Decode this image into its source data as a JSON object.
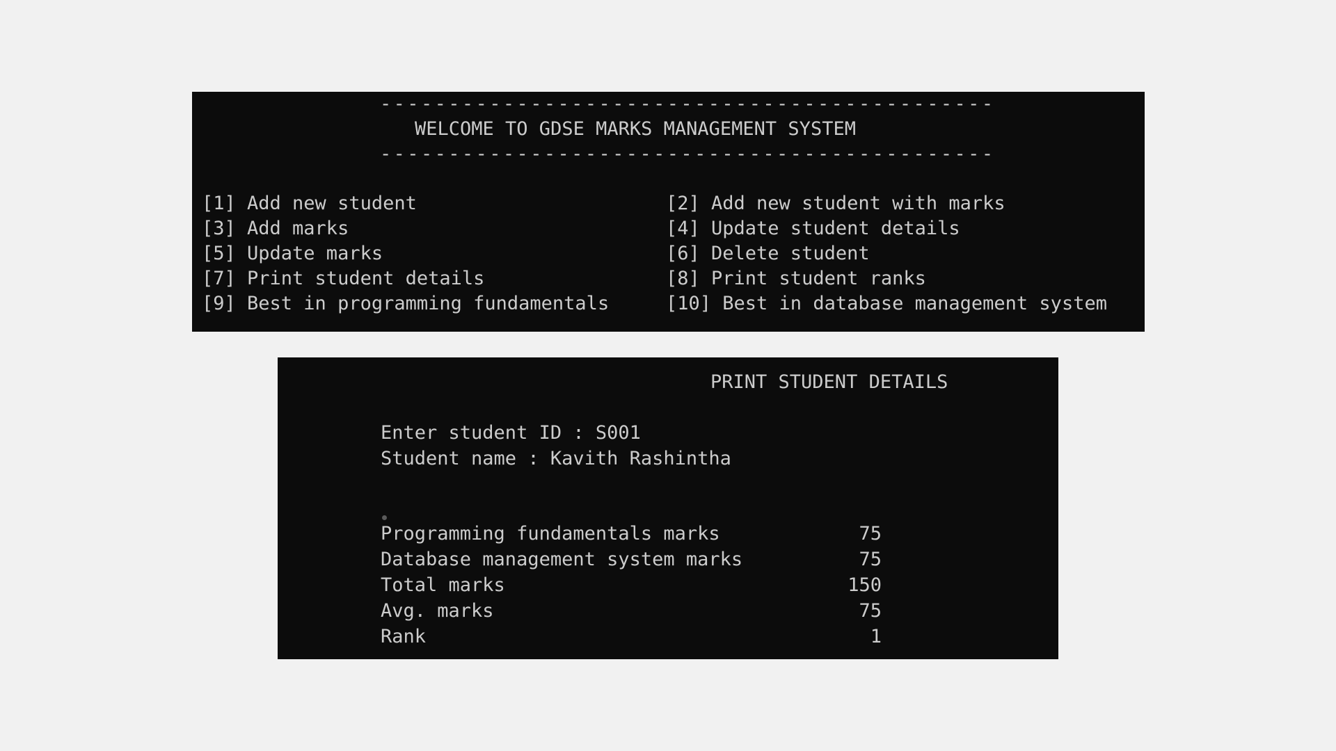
{
  "menu_window": {
    "dash_top": "---------------------------------------------",
    "title": "WELCOME TO GDSE MARKS MANAGEMENT SYSTEM",
    "dash_bottom": "---------------------------------------------",
    "options": [
      {
        "label": "[1] Add new student"
      },
      {
        "label": "[2] Add new student with marks"
      },
      {
        "label": "[3] Add marks"
      },
      {
        "label": "[4] Update student details"
      },
      {
        "label": "[5] Update marks"
      },
      {
        "label": "[6] Delete student"
      },
      {
        "label": "[7] Print student details"
      },
      {
        "label": "[8] Print student ranks"
      },
      {
        "label": "[9] Best in programming fundamentals"
      },
      {
        "label": "[10] Best in database management system"
      }
    ]
  },
  "details_window": {
    "title": "PRINT STUDENT DETAILS",
    "student_id_prompt": "Enter student ID : S001",
    "student_name_line": "Student name : Kavith Rashintha",
    "rows": [
      {
        "label": "Programming fundamentals marks",
        "value": "75"
      },
      {
        "label": "Database management system marks",
        "value": "75"
      },
      {
        "label": "Total marks",
        "value": "150"
      },
      {
        "label": "Avg. marks",
        "value": "75"
      },
      {
        "label": "Rank",
        "value": "1"
      }
    ]
  },
  "colors": {
    "page_background": "#f1f1f1",
    "terminal_background": "#0c0c0c",
    "terminal_text": "#cccccc"
  }
}
